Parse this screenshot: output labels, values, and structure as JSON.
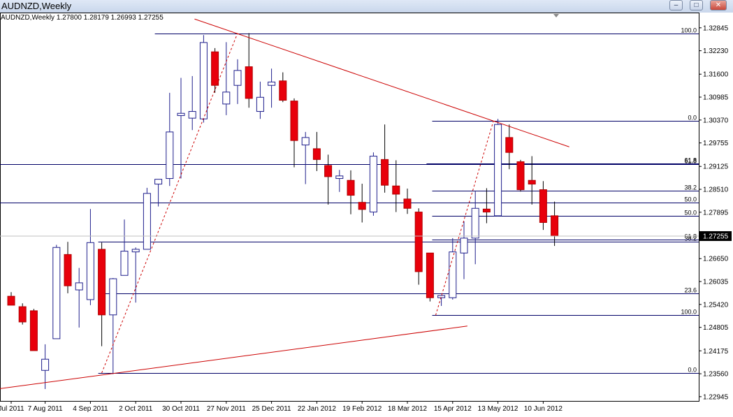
{
  "window": {
    "title": "AUDNZD,Weekly",
    "minimize_glyph": "–",
    "maximize_glyph": "□",
    "close_glyph": "✕"
  },
  "ohlc_line": {
    "symbol": "AUDNZD,Weekly",
    "values": "1.27800 1.28179 1.26993 1.27255"
  },
  "colors": {
    "bull_body": "#ffffff",
    "bull_border": "#1e1e8c",
    "bear_body": "#e8000b",
    "bear_border": "#b00000",
    "fib_line": "#000066",
    "trend_line": "#cc0000",
    "price_badge_bg": "#000000",
    "price_badge_text": "#ffffff"
  },
  "chart_data": {
    "type": "candlestick",
    "symbol": "AUDNZD",
    "timeframe": "Weekly",
    "ylim": [
      1.2283,
      1.3316
    ],
    "y_ticks": [
      "1.32845",
      "1.32230",
      "1.31600",
      "1.30985",
      "1.30370",
      "1.29755",
      "1.29125",
      "1.28510",
      "1.27895",
      "1.27255",
      "1.26650",
      "1.26035",
      "1.25420",
      "1.24805",
      "1.24175",
      "1.23560",
      "1.22945"
    ],
    "x_tick_labels": [
      "Jul 2011",
      "7 Aug 2011",
      "4 Sep 2011",
      "2 Oct 2011",
      "30 Oct 2011",
      "27 Nov 2011",
      "25 Dec 2011",
      "22 Jan 2012",
      "19 Feb 2012",
      "18 Mar 2012",
      "15 Apr 2012",
      "13 May 2012",
      "10 Jun 2012"
    ],
    "x_tick_indexes": [
      0,
      3,
      7,
      11,
      15,
      19,
      23,
      27,
      31,
      35,
      39,
      43,
      47
    ],
    "current_price": "1.27255",
    "candles": [
      {
        "o": 1.2564,
        "h": 1.2575,
        "l": 1.254,
        "c": 1.254
      },
      {
        "o": 1.2536,
        "h": 1.2545,
        "l": 1.2488,
        "c": 1.2495
      },
      {
        "o": 1.2525,
        "h": 1.253,
        "l": 1.2418,
        "c": 1.2418
      },
      {
        "o": 1.2365,
        "h": 1.2435,
        "l": 1.2315,
        "c": 1.2395
      },
      {
        "o": 1.245,
        "h": 1.2702,
        "l": 1.245,
        "c": 1.2695
      },
      {
        "o": 1.2676,
        "h": 1.271,
        "l": 1.2572,
        "c": 1.2592
      },
      {
        "o": 1.2581,
        "h": 1.264,
        "l": 1.248,
        "c": 1.26
      },
      {
        "o": 1.2555,
        "h": 1.2798,
        "l": 1.254,
        "c": 1.2708
      },
      {
        "o": 1.269,
        "h": 1.2708,
        "l": 1.243,
        "c": 1.2514
      },
      {
        "o": 1.2514,
        "h": 1.2613,
        "l": 1.2355,
        "c": 1.2611
      },
      {
        "o": 1.262,
        "h": 1.277,
        "l": 1.262,
        "c": 1.2685
      },
      {
        "o": 1.2683,
        "h": 1.2695,
        "l": 1.2547,
        "c": 1.269
      },
      {
        "o": 1.269,
        "h": 1.2855,
        "l": 1.269,
        "c": 1.284
      },
      {
        "o": 1.2865,
        "h": 1.2876,
        "l": 1.2805,
        "c": 1.2878
      },
      {
        "o": 1.288,
        "h": 1.311,
        "l": 1.286,
        "c": 1.3005
      },
      {
        "o": 1.3049,
        "h": 1.315,
        "l": 1.288,
        "c": 1.3055
      },
      {
        "o": 1.3042,
        "h": 1.3155,
        "l": 1.301,
        "c": 1.306
      },
      {
        "o": 1.304,
        "h": 1.3265,
        "l": 1.303,
        "c": 1.3245
      },
      {
        "o": 1.322,
        "h": 1.323,
        "l": 1.311,
        "c": 1.313
      },
      {
        "o": 1.308,
        "h": 1.3246,
        "l": 1.305,
        "c": 1.3112
      },
      {
        "o": 1.313,
        "h": 1.32,
        "l": 1.308,
        "c": 1.317
      },
      {
        "o": 1.318,
        "h": 1.327,
        "l": 1.307,
        "c": 1.3095
      },
      {
        "o": 1.306,
        "h": 1.314,
        "l": 1.304,
        "c": 1.3098
      },
      {
        "o": 1.313,
        "h": 1.3175,
        "l": 1.307,
        "c": 1.3139
      },
      {
        "o": 1.3142,
        "h": 1.3165,
        "l": 1.3085,
        "c": 1.309
      },
      {
        "o": 1.3088,
        "h": 1.3095,
        "l": 1.291,
        "c": 1.2982
      },
      {
        "o": 1.297,
        "h": 1.3005,
        "l": 1.2865,
        "c": 1.299
      },
      {
        "o": 1.296,
        "h": 1.3005,
        "l": 1.29,
        "c": 1.2931
      },
      {
        "o": 1.2915,
        "h": 1.2944,
        "l": 1.281,
        "c": 1.2885
      },
      {
        "o": 1.288,
        "h": 1.2903,
        "l": 1.2844,
        "c": 1.2887
      },
      {
        "o": 1.2875,
        "h": 1.2902,
        "l": 1.2784,
        "c": 1.2835
      },
      {
        "o": 1.2816,
        "h": 1.2866,
        "l": 1.2762,
        "c": 1.2797
      },
      {
        "o": 1.279,
        "h": 1.295,
        "l": 1.278,
        "c": 1.294
      },
      {
        "o": 1.2931,
        "h": 1.3025,
        "l": 1.2842,
        "c": 1.2862
      },
      {
        "o": 1.286,
        "h": 1.2929,
        "l": 1.279,
        "c": 1.2838
      },
      {
        "o": 1.2825,
        "h": 1.2853,
        "l": 1.2785,
        "c": 1.28
      },
      {
        "o": 1.279,
        "h": 1.28,
        "l": 1.2595,
        "c": 1.263
      },
      {
        "o": 1.268,
        "h": 1.268,
        "l": 1.255,
        "c": 1.256
      },
      {
        "o": 1.256,
        "h": 1.2566,
        "l": 1.2538,
        "c": 1.2566
      },
      {
        "o": 1.256,
        "h": 1.272,
        "l": 1.2555,
        "c": 1.2683
      },
      {
        "o": 1.268,
        "h": 1.2765,
        "l": 1.261,
        "c": 1.272
      },
      {
        "o": 1.272,
        "h": 1.2845,
        "l": 1.265,
        "c": 1.28
      },
      {
        "o": 1.2798,
        "h": 1.2854,
        "l": 1.276,
        "c": 1.279
      },
      {
        "o": 1.278,
        "h": 1.304,
        "l": 1.2778,
        "c": 1.3025
      },
      {
        "o": 1.299,
        "h": 1.3025,
        "l": 1.2905,
        "c": 1.295
      },
      {
        "o": 1.2925,
        "h": 1.293,
        "l": 1.2845,
        "c": 1.285
      },
      {
        "o": 1.2875,
        "h": 1.294,
        "l": 1.281,
        "c": 1.2865
      },
      {
        "o": 1.285,
        "h": 1.2873,
        "l": 1.2742,
        "c": 1.2762
      },
      {
        "o": 1.278,
        "h": 1.2818,
        "l": 1.2699,
        "c": 1.2726
      }
    ],
    "fib_lines": [
      {
        "y": 1.327,
        "x0": 13,
        "x1": 64,
        "label": "100.0"
      },
      {
        "y": 1.2358,
        "x0": 8,
        "x1": 64,
        "label": "0.0"
      },
      {
        "y": 1.3034,
        "x0": 37.5,
        "x1": 64,
        "label": "0.0"
      },
      {
        "y": 1.2513,
        "x0": 37.5,
        "x1": 64,
        "label": "100.0"
      },
      {
        "y": 1.2919,
        "x0": -1,
        "x1": 64,
        "label": "61.8"
      },
      {
        "y": 1.2921,
        "x0": 37,
        "x1": 64,
        "label": "61.8"
      },
      {
        "y": 1.2848,
        "x0": 37.5,
        "x1": 64,
        "label": "38.2"
      },
      {
        "y": 1.2815,
        "x0": -1,
        "x1": 64,
        "label": "50.0"
      },
      {
        "y": 1.278,
        "x0": 37.5,
        "x1": 64,
        "label": "50.0"
      },
      {
        "y": 1.271,
        "x0": 8,
        "x1": 64,
        "label": "38.2"
      },
      {
        "y": 1.2716,
        "x0": 37.5,
        "x1": 64,
        "label": "61.8"
      },
      {
        "y": 1.2571,
        "x0": 8,
        "x1": 64,
        "label": "23.6"
      }
    ],
    "trend_lines": [
      {
        "from": [
          16.2,
          1.3308
        ],
        "to": [
          49.3,
          1.2965
        ],
        "style": "solid"
      },
      {
        "from": [
          -1,
          1.2316
        ],
        "to": [
          40.3,
          1.2484
        ],
        "style": "solid"
      },
      {
        "from": [
          8,
          1.2358
        ],
        "to": [
          20,
          1.327
        ],
        "style": "dashed"
      },
      {
        "from": [
          37.5,
          1.2513
        ],
        "to": [
          42.6,
          1.3034
        ],
        "style": "dashed"
      }
    ]
  }
}
